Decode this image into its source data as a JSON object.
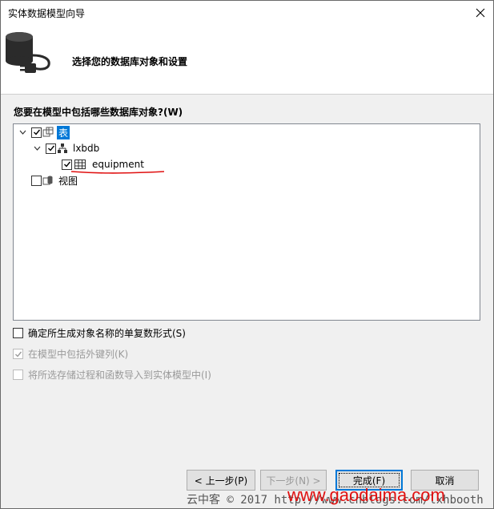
{
  "window": {
    "title": "实体数据模型向导"
  },
  "header": {
    "subtitle": "选择您的数据库对象和设置"
  },
  "question": "您要在模型中包括哪些数据库对象?(W)",
  "tree": {
    "tables": {
      "label": "表",
      "checked": true,
      "expanded": true
    },
    "schema": {
      "label": "lxbdb",
      "checked": true,
      "expanded": true
    },
    "table_item": {
      "label": "equipment",
      "checked": true
    },
    "views": {
      "label": "视图",
      "checked": false
    }
  },
  "options": {
    "pluralize": {
      "label": "确定所生成对象名称的单复数形式(S)",
      "checked": false,
      "enabled": true
    },
    "foreign_keys": {
      "label": "在模型中包括外键列(K)",
      "checked": true,
      "enabled": false
    },
    "import_procs": {
      "label": "将所选存储过程和函数导入到实体模型中(I)",
      "checked": false,
      "enabled": false
    }
  },
  "buttons": {
    "prev": "< 上一步(P)",
    "next": "下一步(N) >",
    "finish": "完成(F)",
    "cancel": "取消"
  },
  "watermark": {
    "line1": "云中客 © 2017 http://www.cnblogs.com/lxhbooth",
    "line2": "www.gaodaima.com"
  },
  "colors": {
    "selection": "#0078d7",
    "annotation": "#e01010"
  }
}
